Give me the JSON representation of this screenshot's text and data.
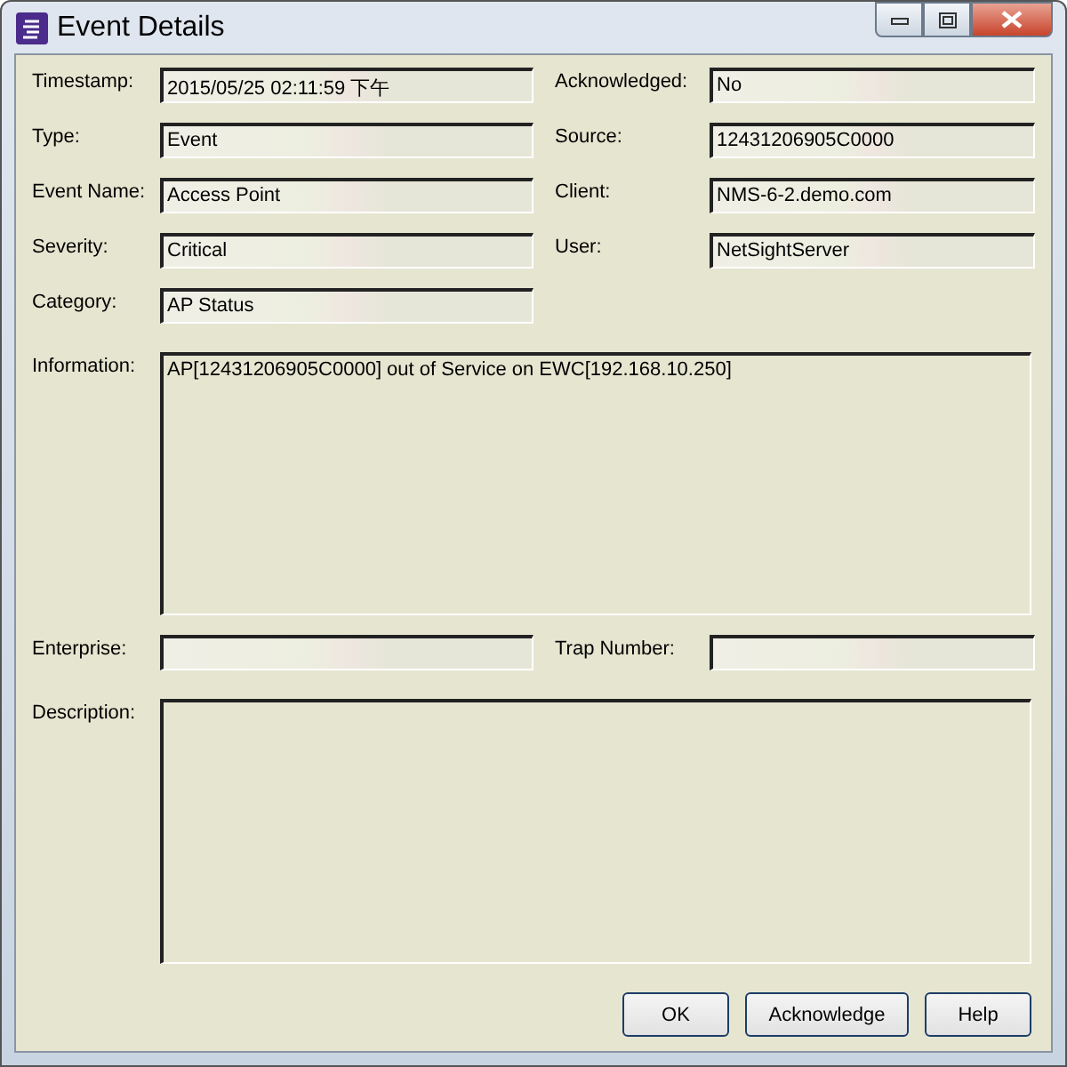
{
  "window": {
    "title": "Event Details"
  },
  "rows": [
    {
      "left": {
        "label": "Timestamp:",
        "value": "2015/05/25 02:11:59 下午"
      },
      "right": {
        "label": "Acknowledged:",
        "value": "No"
      }
    },
    {
      "left": {
        "label": "Type:",
        "value": "Event"
      },
      "right": {
        "label": "Source:",
        "value": "12431206905C0000"
      }
    },
    {
      "left": {
        "label": "Event Name:",
        "value": "Access Point"
      },
      "right": {
        "label": "Client:",
        "value": "NMS-6-2.demo.com"
      }
    },
    {
      "left": {
        "label": "Severity:",
        "value": "Critical"
      },
      "right": {
        "label": "User:",
        "value": "NetSightServer"
      }
    },
    {
      "left": {
        "label": "Category:",
        "value": "AP Status"
      }
    }
  ],
  "information": {
    "label": "Information:",
    "value": "AP[12431206905C0000] out of Service on EWC[192.168.10.250]"
  },
  "enterprise_row": {
    "left": {
      "label": "Enterprise:"
    },
    "right": {
      "label": "Trap Number:"
    }
  },
  "description": {
    "label": "Description:"
  },
  "buttons": [
    "OK",
    "Acknowledge",
    "Help"
  ]
}
